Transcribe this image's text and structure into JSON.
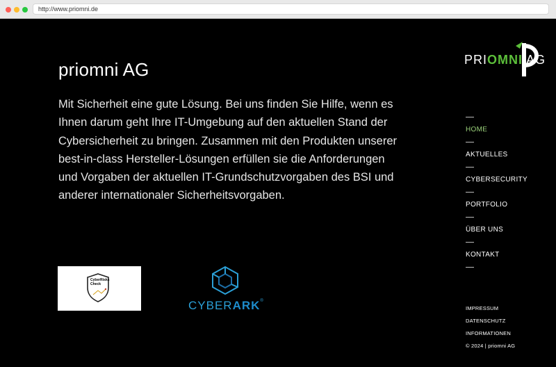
{
  "browser": {
    "url": "http://www.priomni.de"
  },
  "main": {
    "title": "priomni AG",
    "intro": "Mit Sicherheit eine gute Lösung. Bei uns finden Sie Hilfe, wenn es Ihnen darum geht Ihre IT-Umgebung auf den aktuellen Stand der Cybersicherheit zu bringen. Zusammen mit den Produkten unserer best-in-class Hersteller-Lösungen erfüllen sie die Anforderungen und Vorgaben der aktuellen IT-Grundschutzvorgaben des BSI und anderer internationaler Sicherheitsvorgaben."
  },
  "partners": {
    "cyberrisks": "CyberRisks Check",
    "cyberark_a": "CYBER",
    "cyberark_b": "ARK",
    "cyberark_reg": "®"
  },
  "brand": {
    "pri": "PRI",
    "omni": "OMNI",
    "ag": " AG"
  },
  "nav": {
    "items": [
      {
        "label": "HOME",
        "active": true
      },
      {
        "label": "AKTUELLES"
      },
      {
        "label": "CYBERSECURITY"
      },
      {
        "label": "PORTFOLIO"
      },
      {
        "label": "ÜBER UNS"
      },
      {
        "label": "KONTAKT"
      }
    ]
  },
  "footer": {
    "links": [
      "IMPRESSUM",
      "DATENSCHUTZ",
      "INFORMATIONEN"
    ],
    "copyright": "© 2024 | priomni AG"
  },
  "colors": {
    "background": "#000000",
    "accent_green": "#5cbf3a",
    "cyberark_blue": "#1d8ccc"
  }
}
